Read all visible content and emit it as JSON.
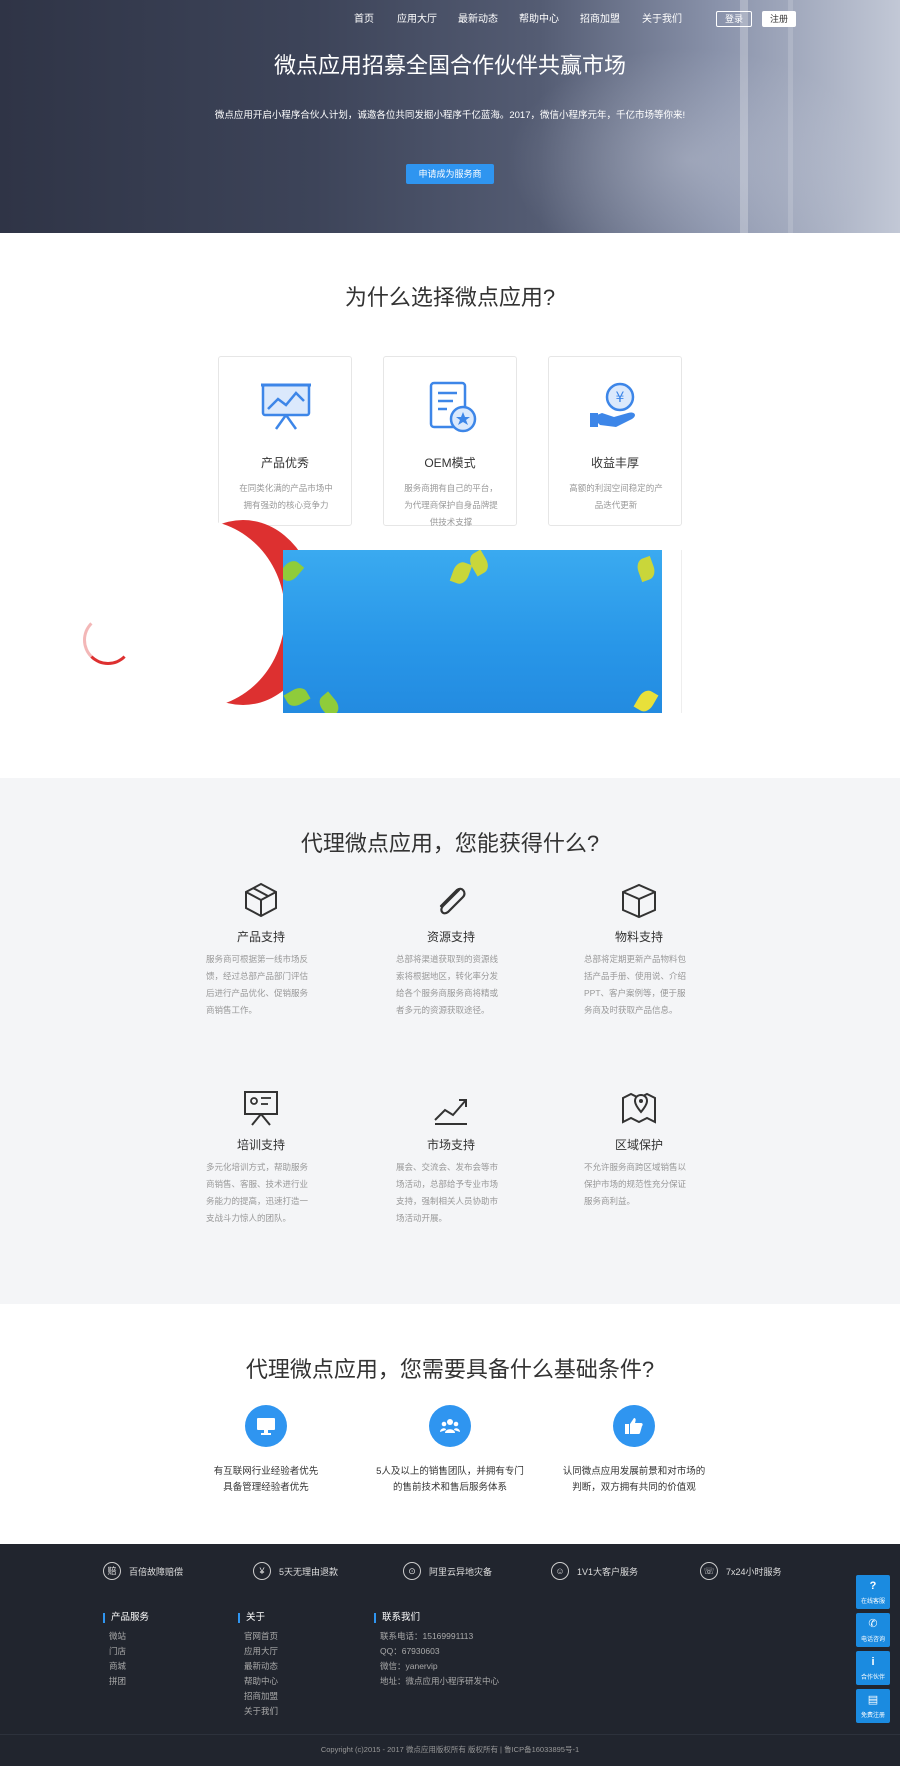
{
  "nav": {
    "items": [
      "首页",
      "应用大厅",
      "最新动态",
      "帮助中心",
      "招商加盟",
      "关于我们"
    ],
    "login": "登录",
    "register": "注册"
  },
  "hero": {
    "title": "微点应用招募全国合作伙伴共赢市场",
    "subtitle": "微点应用开启小程序合伙人计划，诚邀各位共同发掘小程序千亿蓝海。2017，微信小程序元年，千亿市场等你来!",
    "cta": "申请成为服务商"
  },
  "why": {
    "title": "为什么选择微点应用?",
    "cards": [
      {
        "icon": "presentation-chart-icon",
        "title": "产品优秀",
        "desc": "在同类化满的产品市场中拥有强劲的核心竞争力"
      },
      {
        "icon": "document-badge-icon",
        "title": "OEM模式",
        "desc": "服务商拥有自己的平台，为代理商保护自身品牌提供技术支撑"
      },
      {
        "icon": "hand-coin-icon",
        "title": "收益丰厚",
        "desc": "高额的利润空间稳定的产品迭代更新"
      }
    ]
  },
  "get": {
    "title": "代理微点应用，您能获得什么?",
    "features": [
      {
        "icon": "box-icon",
        "title": "产品支持",
        "desc": "服务商可根据第一线市场反馈，经过总部产品部门评估后进行产品优化、促销服务商销售工作。"
      },
      {
        "icon": "paperclip-icon",
        "title": "资源支持",
        "desc": "总部将渠道获取到的资源线索将根据地区，转化率分发给各个服务商服务商将精或者多元的资源获取途径。"
      },
      {
        "icon": "package-icon",
        "title": "物料支持",
        "desc": "总部将定期更新产品物料包括产品手册、使用说、介绍PPT、客户案例等，便于服务商及时获取产品信息。"
      },
      {
        "icon": "training-board-icon",
        "title": "培训支持",
        "desc": "多元化培训方式，帮助服务商销售、客服、技术进行业务能力的提高，迅速打造一支战斗力惊人的团队。"
      },
      {
        "icon": "trend-chart-icon",
        "title": "市场支持",
        "desc": "展会、交流会、发布会等市场活动，总部给予专业市场支持，强制相关人员协助市场活动开展。"
      },
      {
        "icon": "map-pin-icon",
        "title": "区域保护",
        "desc": "不允许服务商跨区域销售以保护市场的规范性充分保证服务商利益。"
      }
    ]
  },
  "need": {
    "title": "代理微点应用，您需要具备什么基础条件?",
    "items": [
      {
        "icon": "monitor-icon",
        "line1": "有互联网行业经验者优先",
        "line2": "具备管理经验者优先"
      },
      {
        "icon": "team-icon",
        "line1": "5人及以上的销售团队，并拥有专门",
        "line2": "的售前技术和售后服务体系"
      },
      {
        "icon": "thumbs-up-icon",
        "line1": "认同微点应用发展前景和对市场的",
        "line2": "判断，双方拥有共同的价值观"
      }
    ]
  },
  "footer": {
    "promises": [
      {
        "icon": "赔",
        "text": "百倍故障赔偿"
      },
      {
        "icon": "¥",
        "text": "5天无理由退款"
      },
      {
        "icon": "⊙",
        "text": "阿里云异地灾备"
      },
      {
        "icon": "☺",
        "text": "1V1大客户服务"
      },
      {
        "icon": "☏",
        "text": "7x24小时服务"
      }
    ],
    "cols": [
      {
        "title": "产品服务",
        "items": [
          "微站",
          "门店",
          "商城",
          "拼团"
        ]
      },
      {
        "title": "关于",
        "items": [
          "官网首页",
          "应用大厅",
          "最新动态",
          "帮助中心",
          "招商加盟",
          "关于我们"
        ]
      },
      {
        "title": "联系我们",
        "items": [
          "联系电话：15169991113",
          "QQ：67930603",
          "微信：yanervip",
          "地址：微点应用小程序研发中心"
        ]
      }
    ],
    "copyright": "Copyright (c)2015 - 2017 微点应用版权所有 版权所有 | 鲁ICP备16033895号-1"
  },
  "float": [
    {
      "icon": "?",
      "label": "在线客服",
      "name": "online-service"
    },
    {
      "icon": "✆",
      "label": "电话咨询",
      "name": "phone-consult"
    },
    {
      "icon": "i",
      "label": "合作伙伴",
      "name": "partner"
    },
    {
      "icon": "▤",
      "label": "免费注册",
      "name": "free-register"
    }
  ],
  "colors": {
    "accent": "#2f95f0",
    "footer_bg": "#21252e",
    "muted_bg": "#f4f5f7"
  }
}
